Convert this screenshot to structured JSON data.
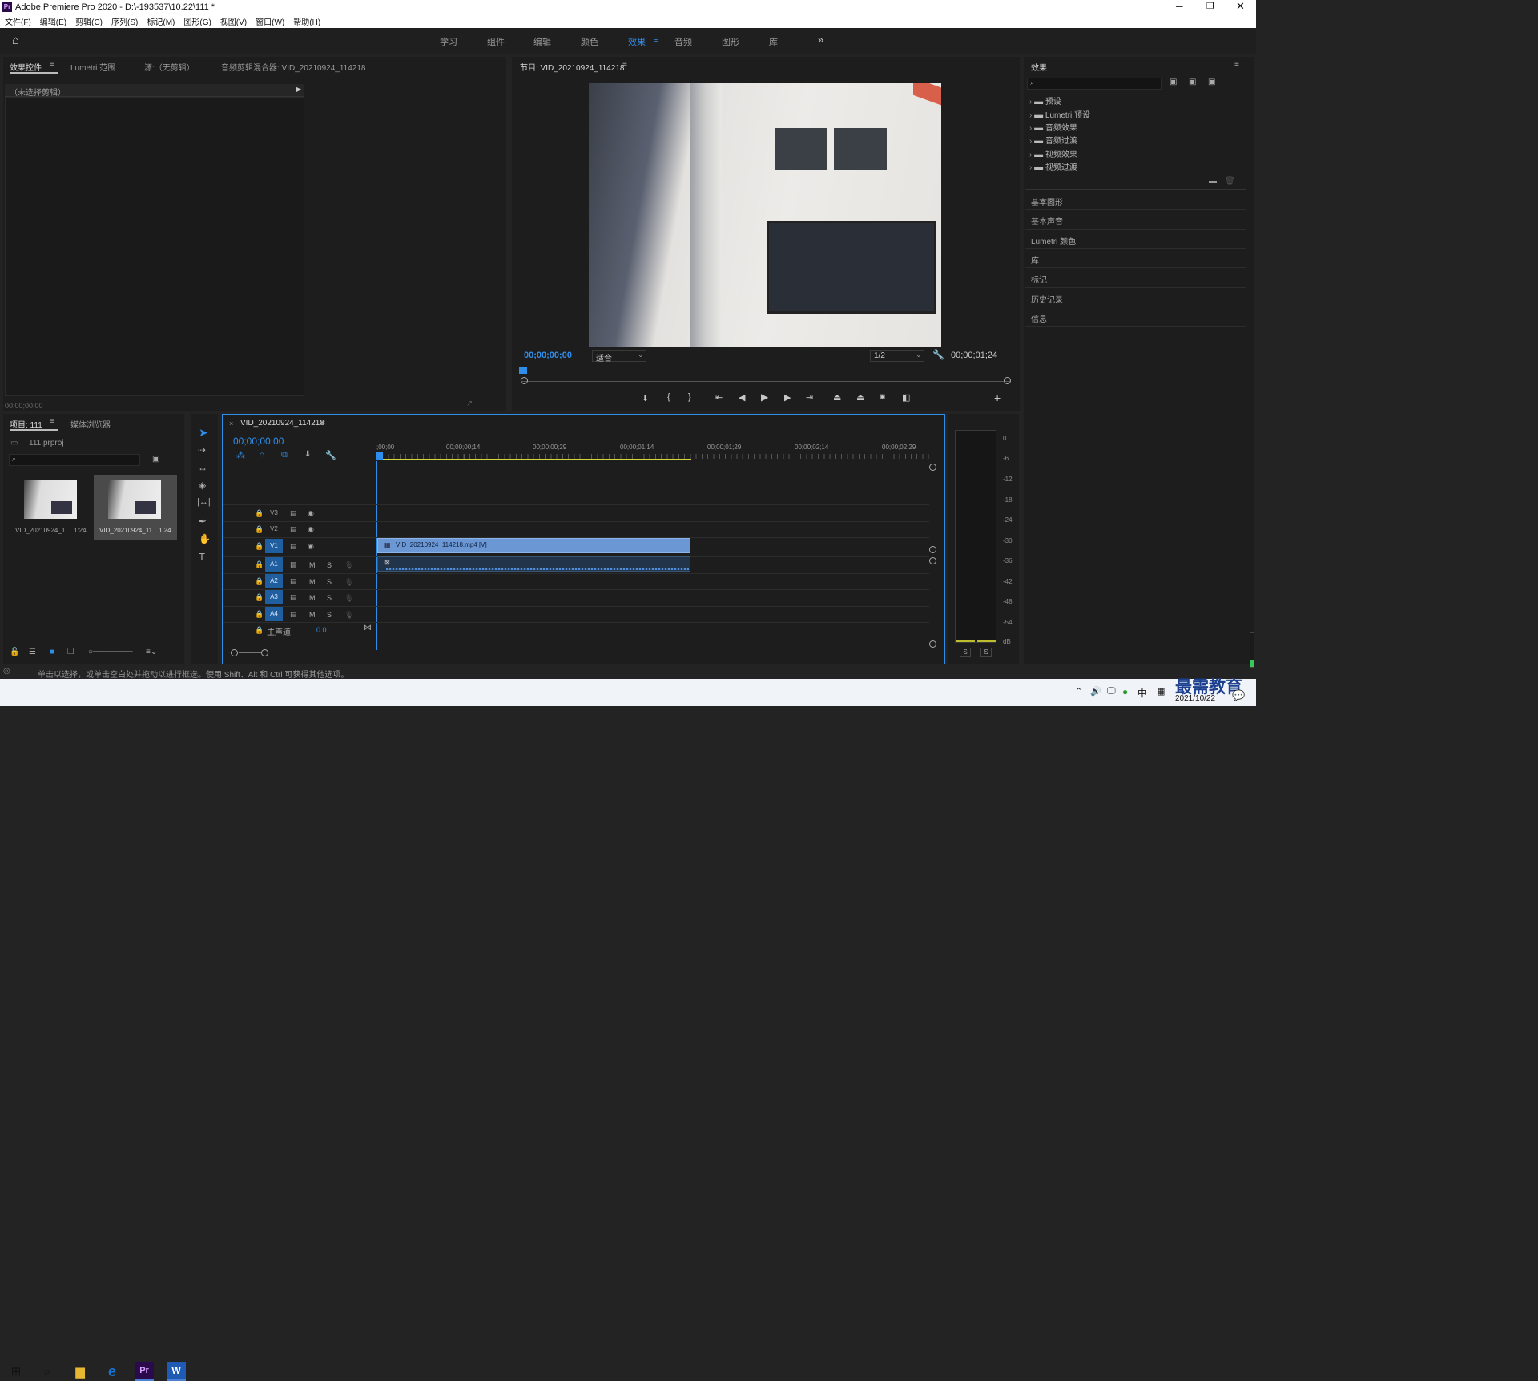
{
  "app": {
    "title": "Adobe Premiere Pro 2020 - D:\\-193537\\10.22\\111 *",
    "logo": "Pr"
  },
  "menu": [
    "文件(F)",
    "编辑(E)",
    "剪辑(C)",
    "序列(S)",
    "标记(M)",
    "图形(G)",
    "视图(V)",
    "窗口(W)",
    "帮助(H)"
  ],
  "workspaces": {
    "items": [
      "学习",
      "组件",
      "编辑",
      "颜色",
      "效果",
      "音频",
      "图形",
      "库"
    ],
    "active": "效果",
    "more": "»"
  },
  "source_panel": {
    "tabs": [
      "效果控件",
      "Lumetri 范围",
      "源:（无剪辑）",
      "音频剪辑混合器: VID_20210924_114218"
    ],
    "no_clip": "（未选择剪辑）",
    "timecode": "00;00;00;00"
  },
  "program_monitor": {
    "title": "节目: VID_20210924_114218",
    "timecode_left": "00;00;00;00",
    "fit": "适合",
    "resolution": "1/2",
    "duration": "00;00;01;24",
    "controls": [
      "marker-icon",
      "in-point-icon",
      "out-point-icon",
      "go-to-in-icon",
      "step-back-icon",
      "play-icon",
      "step-forward-icon",
      "go-to-out-icon",
      "lift-icon",
      "extract-icon",
      "camera-icon",
      "compare-icon",
      "add-icon"
    ]
  },
  "effects_panel": {
    "title": "效果",
    "search_placeholder": "",
    "folders": [
      "预设",
      "Lumetri 预设",
      "音频效果",
      "音频过渡",
      "视频效果",
      "视频过渡"
    ],
    "sections": [
      "基本图形",
      "基本声音",
      "Lumetri 颜色",
      "库",
      "标记",
      "历史记录",
      "信息"
    ]
  },
  "project_panel": {
    "tabs": [
      "项目: 111",
      "媒体浏览器"
    ],
    "file": "111.prproj",
    "items": [
      {
        "name": "VID_20210924_1...",
        "duration": "1:24"
      },
      {
        "name": "VID_20210924_11...",
        "duration": "1:24"
      }
    ]
  },
  "timeline": {
    "sequence": "VID_20210924_114218",
    "timecode": "00;00;00;00",
    "ruler": [
      ";00;00",
      "00;00;00;14",
      "00;00;00;29",
      "00;00;01;14",
      "00;00;01;29",
      "00;00;02;14",
      "00;00;02;29"
    ],
    "video_tracks": [
      "V3",
      "V2",
      "V1"
    ],
    "audio_tracks": [
      "A1",
      "A2",
      "A3",
      "A4"
    ],
    "master": "主声道",
    "master_value": "0.0",
    "clip_label": "VID_20210924_114218.mp4 [V]"
  },
  "meter": {
    "scale": [
      "0",
      "-6",
      "-12",
      "-18",
      "-24",
      "-30",
      "-36",
      "-42",
      "-48",
      "-54",
      "dB"
    ],
    "solo": [
      "S",
      "S"
    ]
  },
  "status": "单击以选择，或单击空白处并拖动以进行框选。使用 Shift、Alt 和 Ctrl 可获得其他选项。",
  "taskbar": {
    "ime": "中",
    "date": "2021/10/22",
    "watermark": "最需教育"
  }
}
